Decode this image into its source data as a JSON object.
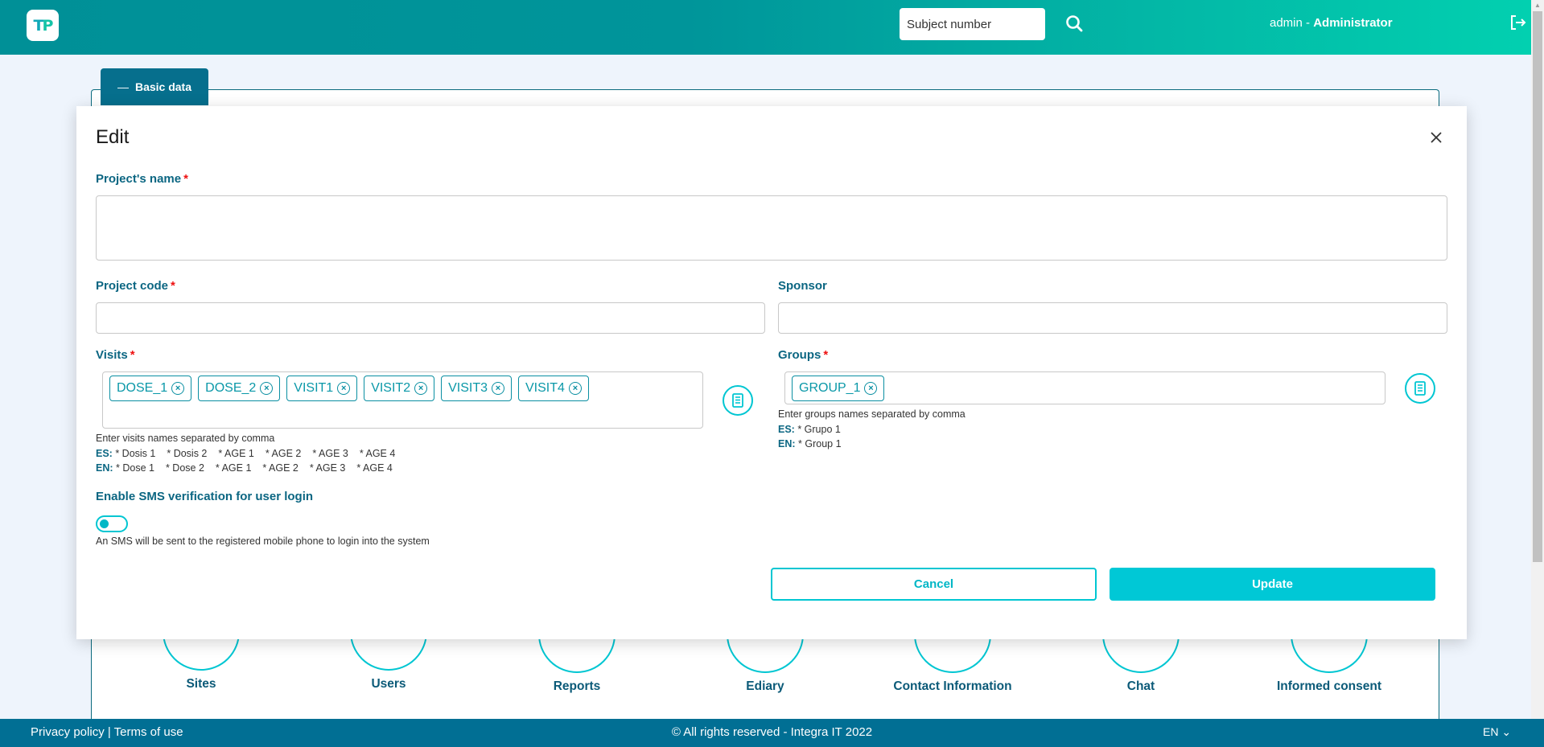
{
  "header": {
    "logo_text_a": "T",
    "logo_text_b": "P",
    "subject_search_placeholder": "Subject number",
    "user_name": "admin",
    "user_separator": " - ",
    "user_role": "Administrator",
    "icons": {
      "search": "search-icon",
      "logout": "logout-icon"
    }
  },
  "page": {
    "tab_label": "Basic data",
    "tab_icon": "minus-icon",
    "modules": [
      {
        "label": "Sites"
      },
      {
        "label": "Users"
      },
      {
        "label": "Reports"
      },
      {
        "label": "Ediary"
      },
      {
        "label": "Contact Information"
      },
      {
        "label": "Chat"
      },
      {
        "label": "Informed consent"
      }
    ]
  },
  "modal": {
    "title": "Edit",
    "close_icon": "close-icon",
    "required_mark": "*",
    "project_name": {
      "label": "Project's name",
      "value": ""
    },
    "project_code": {
      "label": "Project code",
      "value": ""
    },
    "sponsor": {
      "label": "Sponsor",
      "value": ""
    },
    "visits": {
      "label": "Visits",
      "tags": [
        "DOSE_1",
        "DOSE_2",
        "VISIT1",
        "VISIT2",
        "VISIT3",
        "VISIT4"
      ],
      "help": "Enter visits names separated by comma",
      "es_label": "ES:",
      "es_items": [
        "* Dosis 1",
        "* Dosis 2",
        "* AGE 1",
        "* AGE 2",
        "* AGE 3",
        "* AGE 4"
      ],
      "en_label": "EN:",
      "en_items": [
        "* Dose 1",
        "* Dose 2",
        "* AGE 1",
        "* AGE 2",
        "* AGE 3",
        "* AGE 4"
      ]
    },
    "groups": {
      "label": "Groups",
      "tags": [
        "GROUP_1"
      ],
      "help": "Enter groups names separated by comma",
      "es_label": "ES:",
      "es_items": [
        "* Grupo 1"
      ],
      "en_label": "EN:",
      "en_items": [
        "* Group 1"
      ]
    },
    "sms": {
      "label": "Enable SMS verification for user login",
      "enabled": false,
      "help": "An SMS will be sent to the registered mobile phone to login into the system"
    },
    "cancel_label": "Cancel",
    "update_label": "Update"
  },
  "footer": {
    "privacy": "Privacy policy",
    "separator": " | ",
    "terms": "Terms of use",
    "copyright": "© All rights reserved - Integra IT 2022",
    "language": "EN"
  },
  "colors": {
    "accent": "#00c8d6",
    "label": "#0b6682",
    "footer": "#016f94",
    "header_start": "#009097",
    "header_end": "#02d0b0"
  }
}
